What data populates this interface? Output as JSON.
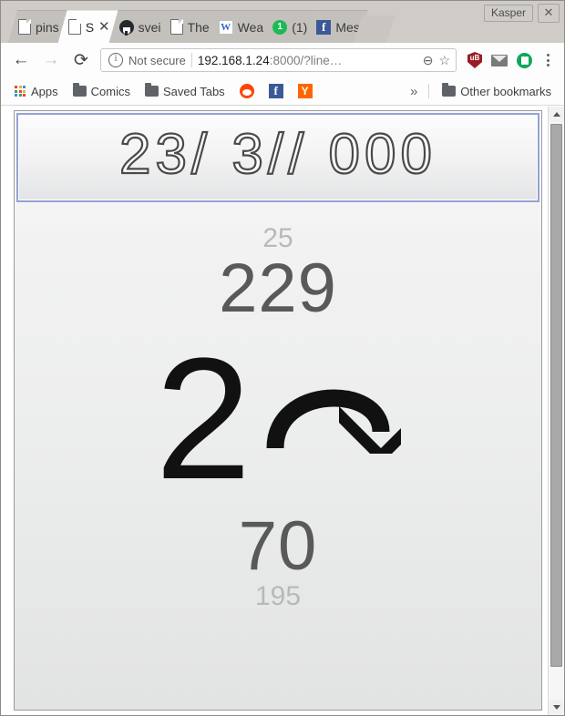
{
  "window": {
    "profile_label": "Kasper",
    "close_label": "✕"
  },
  "tabs": [
    {
      "label": "pins",
      "icon": "page-icon",
      "active": false
    },
    {
      "label": "S",
      "icon": "page-icon",
      "active": true,
      "close": "✕"
    },
    {
      "label": "svei",
      "icon": "github-icon",
      "active": false
    },
    {
      "label": "The",
      "icon": "page-icon",
      "active": false
    },
    {
      "label": "Wea",
      "icon": "wikipedia-icon",
      "active": false
    },
    {
      "label": "(1)",
      "icon": "green-badge-icon",
      "badge": "1",
      "active": false
    },
    {
      "label": "Mes",
      "icon": "facebook-icon",
      "active": false
    }
  ],
  "toolbar": {
    "back": "←",
    "forward": "→",
    "reload": "⟳",
    "security_label": "Not secure",
    "info_glyph": "i",
    "url_host": "192.168.1.24",
    "url_path": ":8000/?line…",
    "zoom_icon": "⊖",
    "bookmark_star": "☆",
    "ublock_label": "uB",
    "menu_dots": "⋮"
  },
  "bookmarks": {
    "apps_label": "Apps",
    "items": [
      {
        "label": "Comics",
        "icon": "folder-icon"
      },
      {
        "label": "Saved Tabs",
        "icon": "folder-icon"
      },
      {
        "label": "",
        "icon": "reddit-icon"
      },
      {
        "label": "",
        "icon": "facebook-icon"
      },
      {
        "label": "",
        "icon": "ycombinator-icon"
      }
    ],
    "overflow": "»",
    "other_label": "Other bookmarks"
  },
  "page": {
    "display_value": "23/ 3// 000",
    "top_small": "25",
    "top_big": "229",
    "glyph_digit": "2",
    "glyph_arrow_name": "curved-down-arrow-icon",
    "bottom_big": "70",
    "bottom_small": "195"
  },
  "scrollbar": {
    "up": "▲",
    "down": "▼"
  },
  "colors": {
    "focus_border": "#94a3d4",
    "big_number": "#595959",
    "small_number": "#b9b9b9",
    "chrome_bg": "#d6d2ce"
  }
}
